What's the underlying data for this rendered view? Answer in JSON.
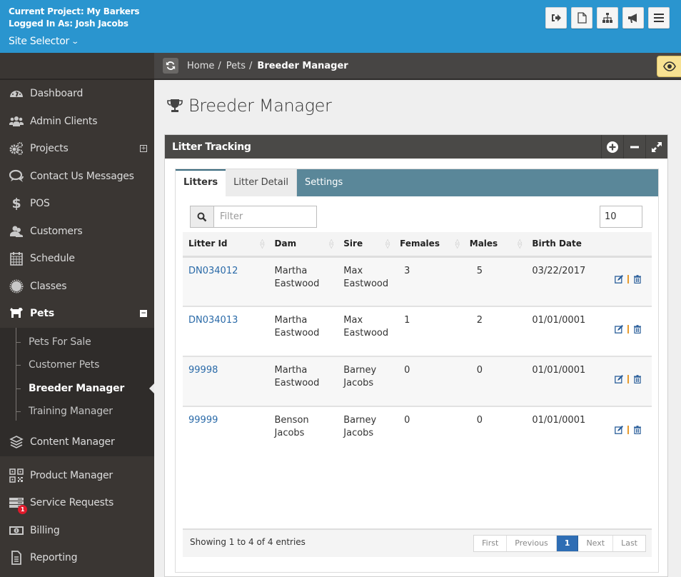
{
  "header": {
    "current_project": "Current Project: My Barkers",
    "logged_in": "Logged In As: Josh Jacobs",
    "site_selector": "Site Selector",
    "buttons": [
      {
        "name": "logout",
        "icon": "sign-out-icon"
      },
      {
        "name": "page",
        "icon": "file-icon"
      },
      {
        "name": "sitemap",
        "icon": "sitemap-icon"
      },
      {
        "name": "announce",
        "icon": "bullhorn-icon"
      },
      {
        "name": "menu",
        "icon": "hamburger-icon"
      }
    ],
    "colors": {
      "brand": "#2a95cf"
    }
  },
  "sidebar": {
    "items": [
      {
        "label": "Dashboard",
        "icon": "dashboard-icon"
      },
      {
        "label": "Admin Clients",
        "icon": "users-icon"
      },
      {
        "label": "Projects",
        "icon": "gears-icon",
        "expander": "+"
      },
      {
        "label": "Contact Us Messages",
        "icon": "comments-icon"
      },
      {
        "label": "POS",
        "icon": "dollar-icon"
      },
      {
        "label": "Customers",
        "icon": "user-group-icon"
      },
      {
        "label": "Schedule",
        "icon": "calendar-icon"
      },
      {
        "label": "Classes",
        "icon": "badge-icon"
      },
      {
        "label": "Pets",
        "icon": "dog-icon",
        "expander": "−"
      }
    ],
    "pets_sub": [
      {
        "label": "Pets For Sale"
      },
      {
        "label": "Customer Pets"
      },
      {
        "label": "Breeder Manager"
      },
      {
        "label": "Training Manager"
      }
    ],
    "lower_items": [
      {
        "label": "Content Manager",
        "icon": "layers-icon"
      },
      {
        "label": "Product Manager",
        "icon": "qrcode-icon"
      },
      {
        "label": "Service Requests",
        "icon": "server-icon",
        "badge": "1"
      },
      {
        "label": "Billing",
        "icon": "money-icon"
      },
      {
        "label": "Reporting",
        "icon": "report-icon"
      }
    ]
  },
  "breadcrumb": {
    "items": [
      "Home",
      "Pets"
    ],
    "current": "Breeder Manager",
    "separator": "/"
  },
  "page": {
    "title": "Breeder Manager",
    "title_icon": "trophy-icon"
  },
  "panel": {
    "title": "Litter Tracking",
    "tabs": [
      {
        "label": "Litters",
        "state": "active"
      },
      {
        "label": "Litter Detail",
        "state": "inactive"
      },
      {
        "label": "Settings",
        "state": "normal"
      }
    ],
    "filter_placeholder": "Filter",
    "filter_value": "",
    "page_size": "10",
    "columns": [
      "Litter Id",
      "Dam",
      "Sire",
      "Females",
      "Males",
      "Birth Date"
    ],
    "rows": [
      {
        "id": "DN034012",
        "dam": [
          "Martha",
          "Eastwood"
        ],
        "sire": [
          "Max",
          "Eastwood"
        ],
        "females": "3",
        "males": "5",
        "birth": "03/22/2017"
      },
      {
        "id": "DN034013",
        "dam": [
          "Martha",
          "Eastwood"
        ],
        "sire": [
          "Max",
          "Eastwood"
        ],
        "females": "1",
        "males": "2",
        "birth": "01/01/0001"
      },
      {
        "id": "99998",
        "dam": [
          "Martha",
          "Eastwood"
        ],
        "sire": [
          "Barney",
          "Jacobs"
        ],
        "females": "0",
        "males": "0",
        "birth": "01/01/0001"
      },
      {
        "id": "99999",
        "dam": [
          "Benson",
          "Jacobs"
        ],
        "sire": [
          "Barney",
          "Jacobs"
        ],
        "females": "0",
        "males": "0",
        "birth": "01/01/0001"
      }
    ],
    "info": "Showing 1 to 4 of 4 entries",
    "pager": {
      "first": "First",
      "previous": "Previous",
      "current": "1",
      "next": "Next",
      "last": "Last"
    }
  }
}
